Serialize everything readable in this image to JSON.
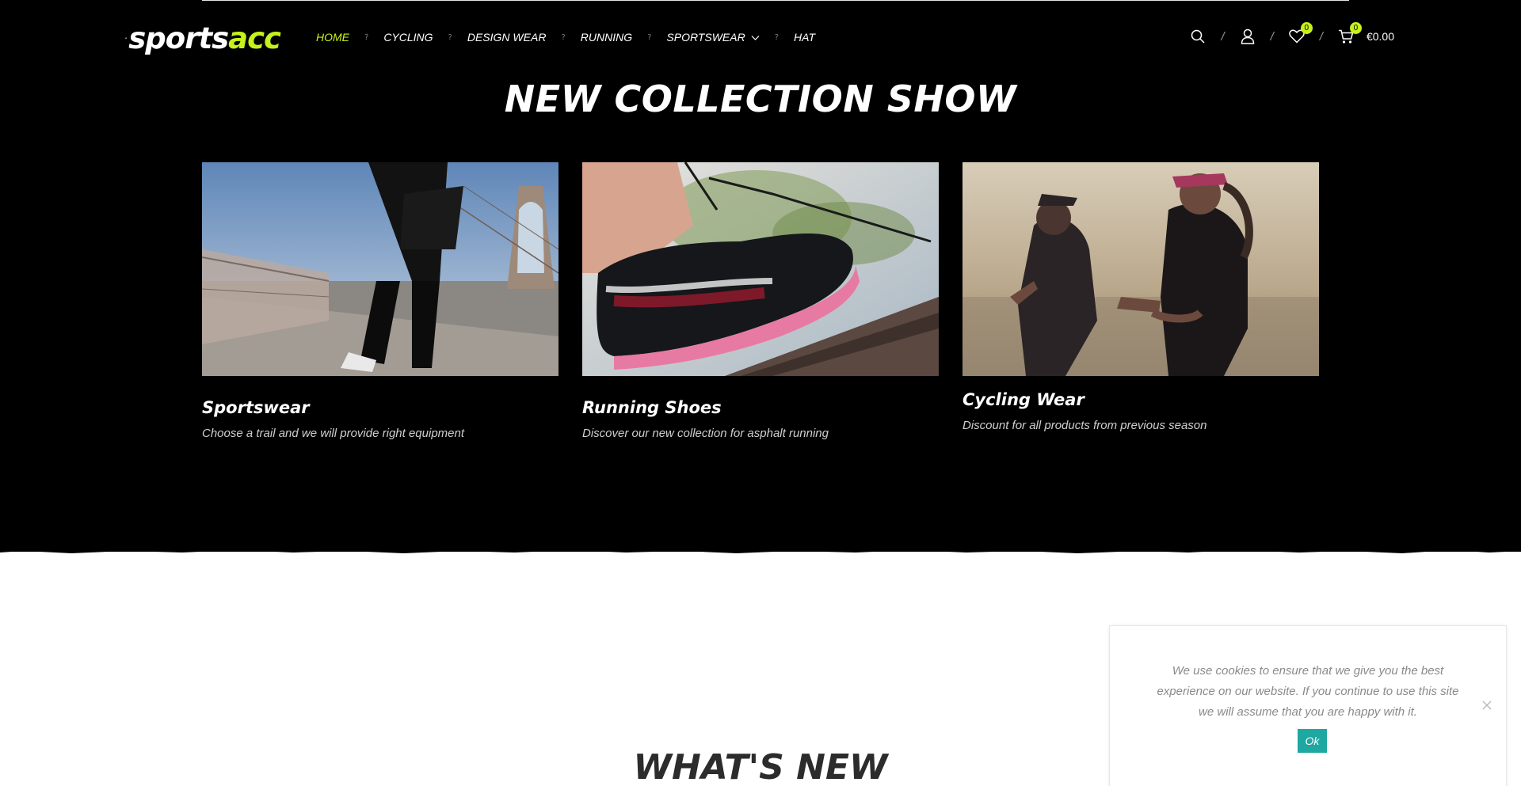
{
  "colors": {
    "accent": "#c6f11a",
    "background_dark": "#000000",
    "cookie_button": "#1fa7a1"
  },
  "logo": {
    "part1": "sports",
    "part2": "acc",
    "icon": "sportsacc-logo-icon"
  },
  "nav": {
    "items": [
      {
        "label": "HOME",
        "active": true
      },
      {
        "label": "CYCLING"
      },
      {
        "label": "DESIGN WEAR"
      },
      {
        "label": "RUNNING"
      },
      {
        "label": "SPORTSWEAR",
        "has_dropdown": true
      },
      {
        "label": "HAT"
      }
    ],
    "separator": "?"
  },
  "header_icons": {
    "search": "search-icon",
    "account": "user-icon",
    "wishlist": "heart-icon",
    "wishlist_count": "0",
    "cart": "cart-icon",
    "cart_count": "0",
    "cart_total": "€0.00",
    "divider": "/"
  },
  "collection": {
    "title": "NEW COLLECTION SHOW",
    "cards": [
      {
        "title": "Sportswear",
        "description": "Choose a trail and we will provide right equipment"
      },
      {
        "title": "Running Shoes",
        "description": "Discover our new collection for asphalt running"
      },
      {
        "title": "Cycling Wear",
        "description": "Discount for all products from previous season"
      }
    ]
  },
  "whats_new": {
    "title": "WHAT'S NEW"
  },
  "cookie_notice": {
    "text": "We use cookies to ensure that we give you the best experience on our website. If you continue to use this site we will assume that you are happy with it.",
    "ok_label": "Ok"
  }
}
